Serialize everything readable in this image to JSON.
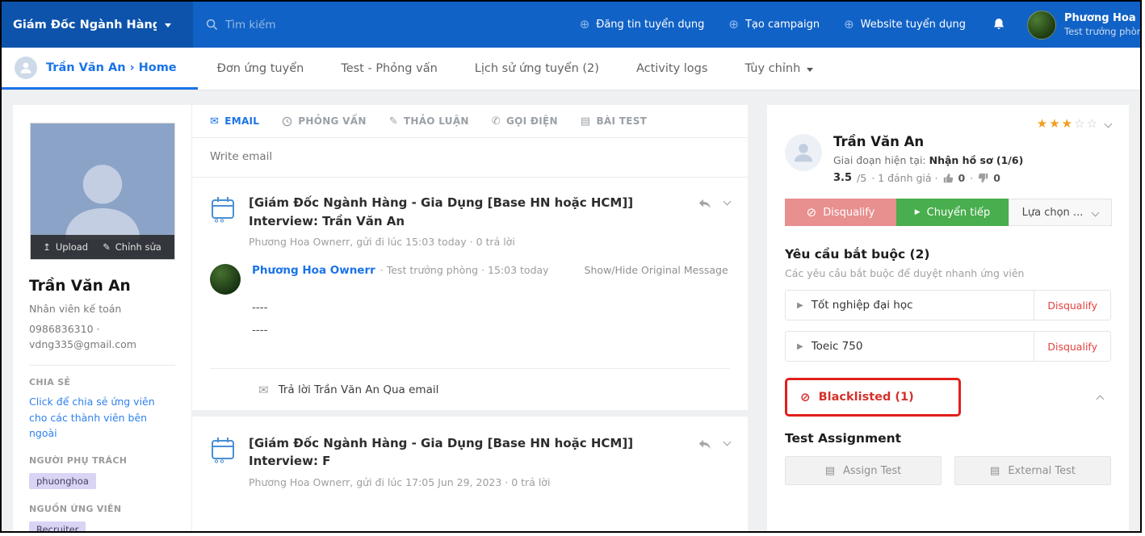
{
  "colors": {
    "topbar": "#1162c6",
    "accent": "#1a73e8",
    "danger": "#e0201b",
    "success": "#49ae4d",
    "disqualify": "#e88f8f",
    "badge": "#dad4f4",
    "star": "#f39c1f"
  },
  "topbar": {
    "project_dropdown": "Giám Đốc Ngành Hàng - Gi...",
    "search_placeholder": "Tìm kiếm",
    "actions": [
      {
        "label": "Đăng tin tuyển dụng"
      },
      {
        "label": "Tạo campaign"
      },
      {
        "label": "Website tuyển dụng"
      }
    ],
    "user": {
      "name": "Phương Hoa ...",
      "role": "Test trưởng phòng"
    }
  },
  "nav": {
    "breadcrumb": "Trần Văn An › Home",
    "tabs": [
      {
        "label": "Đơn ứng tuyển"
      },
      {
        "label": "Test - Phỏng vấn"
      },
      {
        "label": "Lịch sử ứng tuyển (2)"
      },
      {
        "label": "Activity logs"
      },
      {
        "label": "Tùy chỉnh"
      }
    ]
  },
  "profile": {
    "upload_label": "Upload",
    "edit_label": "Chỉnh sửa",
    "name": "Trần Văn An",
    "job_title": "Nhân viên kế toán",
    "phone": "0986836310 ·",
    "email": "vdng335@gmail.com",
    "share_label": "CHIA SẺ",
    "share_link": "Click để chia sẻ ứng viên cho các thành viên bên ngoài",
    "assignee_label": "NGƯỜI PHỤ TRÁCH",
    "assignee": "phuonghoa",
    "source_label": "NGUỒN ỨNG VIÊN",
    "source": "Recruiter"
  },
  "thread": {
    "tabs": [
      {
        "label": "EMAIL"
      },
      {
        "label": "PHỎNG VẤN"
      },
      {
        "label": "THẢO LUẬN"
      },
      {
        "label": "GỌI ĐIỆN"
      },
      {
        "label": "BÀI TEST"
      }
    ],
    "compose_placeholder": "Write email",
    "emails": [
      {
        "subject": "[Giám Đốc Ngành Hàng - Gia Dụng [Base HN hoặc HCM]] Interview: Trần Văn An",
        "meta": "Phương Hoa Ownerr, gửi đi lúc 15:03 today · 0 trả lời"
      },
      {
        "subject": "[Giám Đốc Ngành Hàng - Gia Dụng [Base HN hoặc HCM]] Interview: F",
        "meta": "Phương Hoa Ownerr, gửi đi lúc 17:05 Jun 29, 2023 · 0 trả lời"
      }
    ],
    "message": {
      "sender": "Phương Hoa Ownerr",
      "sender_meta": "· Test trưởng phòng · 15:03 today",
      "toggle": "Show/Hide Original Message",
      "body_line1": "----",
      "body_line2": "----",
      "reply_label": "Trả lời Trần Văn An Qua email"
    }
  },
  "candidate": {
    "name": "Trần Văn An",
    "stage_label": "Giai đoạn hiện tại:",
    "stage_value": "Nhận hồ sơ (1/6)",
    "stars_filled_str": "★★★",
    "stars_empty_str": "☆☆",
    "rating_score": "3.5",
    "rating_max": "/5",
    "rating_meta": "· 1 đánh giá ·",
    "likes": "0",
    "dot": "·",
    "dislikes": "0",
    "disqualify_button": "Disqualify",
    "forward_button": "Chuyển tiếp",
    "options_button": "Lựa chọn ...",
    "requirements_title": "Yêu cầu bắt buộc (2)",
    "requirements_subtitle": "Các yêu cầu bắt buộc để duyệt nhanh ứng viên",
    "requirements": [
      {
        "label": "Tốt nghiệp đại học",
        "action": "Disqualify"
      },
      {
        "label": "Toeic 750",
        "action": "Disqualify"
      }
    ],
    "blacklisted_label": "Blacklisted (1)",
    "test_assignment_title": "Test Assignment",
    "assign_test_button": "Assign Test",
    "external_test_button": "External Test"
  }
}
